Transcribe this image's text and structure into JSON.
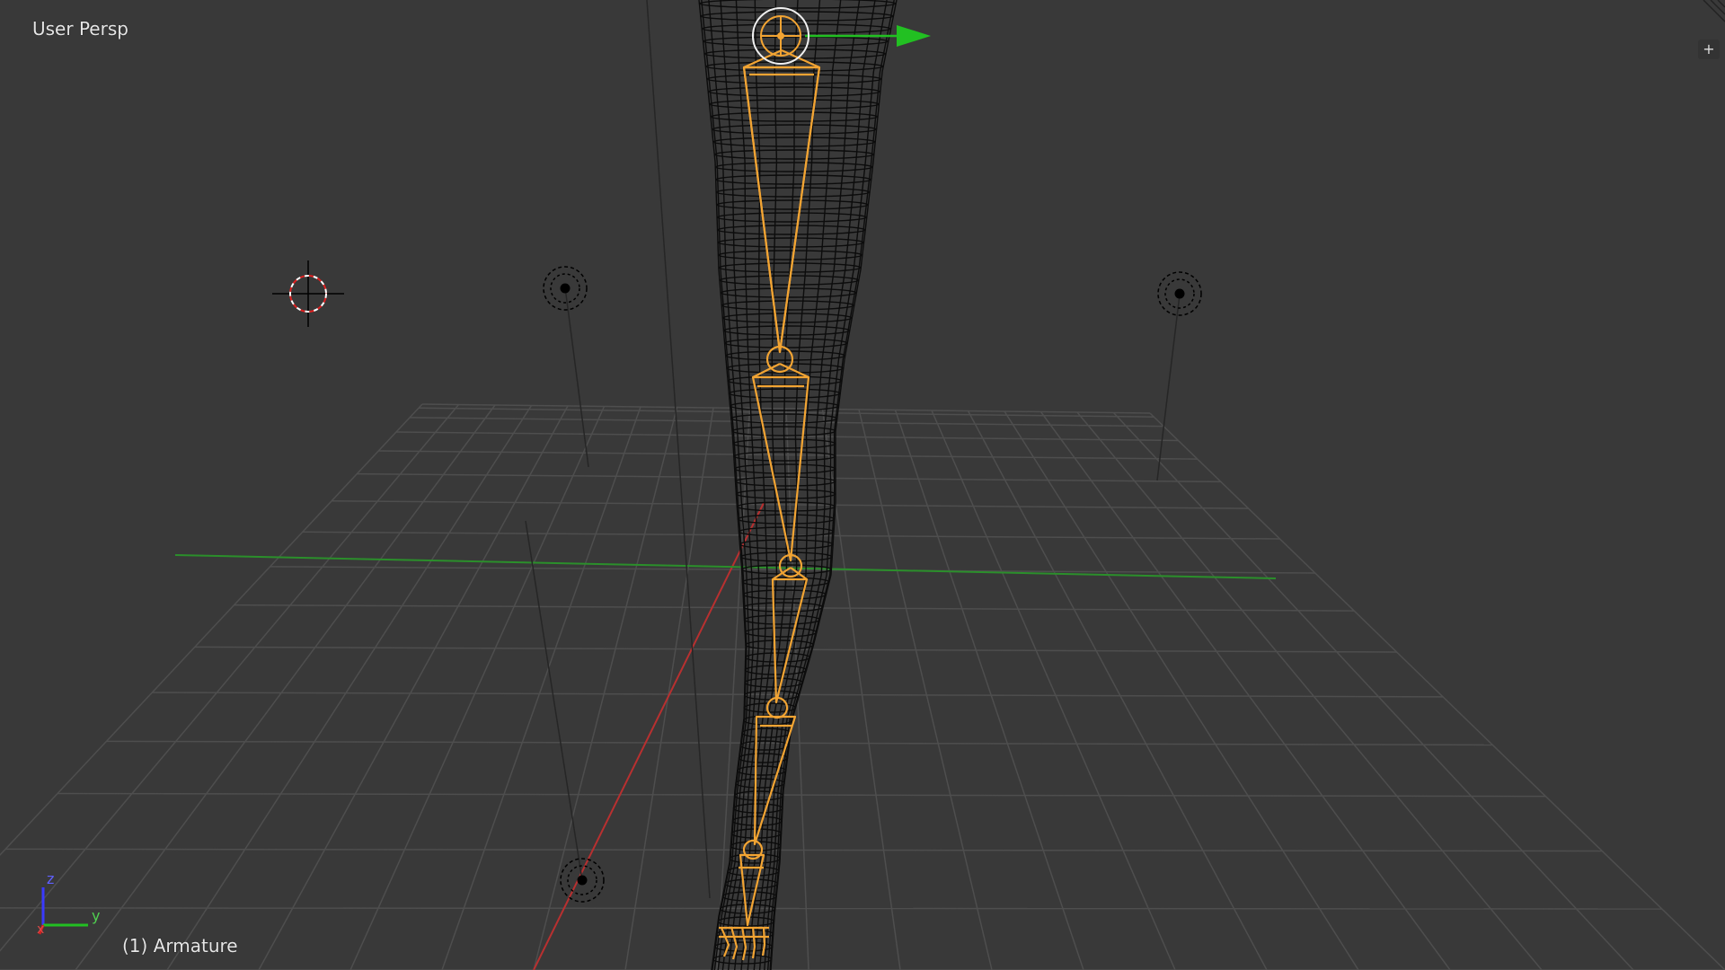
{
  "viewport": {
    "view_name": "User Persp",
    "object_info": "(1) Armature"
  },
  "axes": {
    "x": "x",
    "y": "y",
    "z": "z"
  },
  "ui": {
    "properties_toggle": "+"
  },
  "colors": {
    "background": "#393939",
    "grid": "#4f4f4f",
    "x_axis": "#c83232",
    "y_axis": "#2f9a2f",
    "armature_selected": "#f0a030",
    "mesh_wire": "#0a0a0a",
    "manipulator_y": "#2ad02a"
  },
  "scene_objects": [
    "grid-floor",
    "mesh-leg",
    "armature",
    "lamp",
    "lamp",
    "lamp",
    "3d-cursor",
    "transform-manipulator"
  ]
}
